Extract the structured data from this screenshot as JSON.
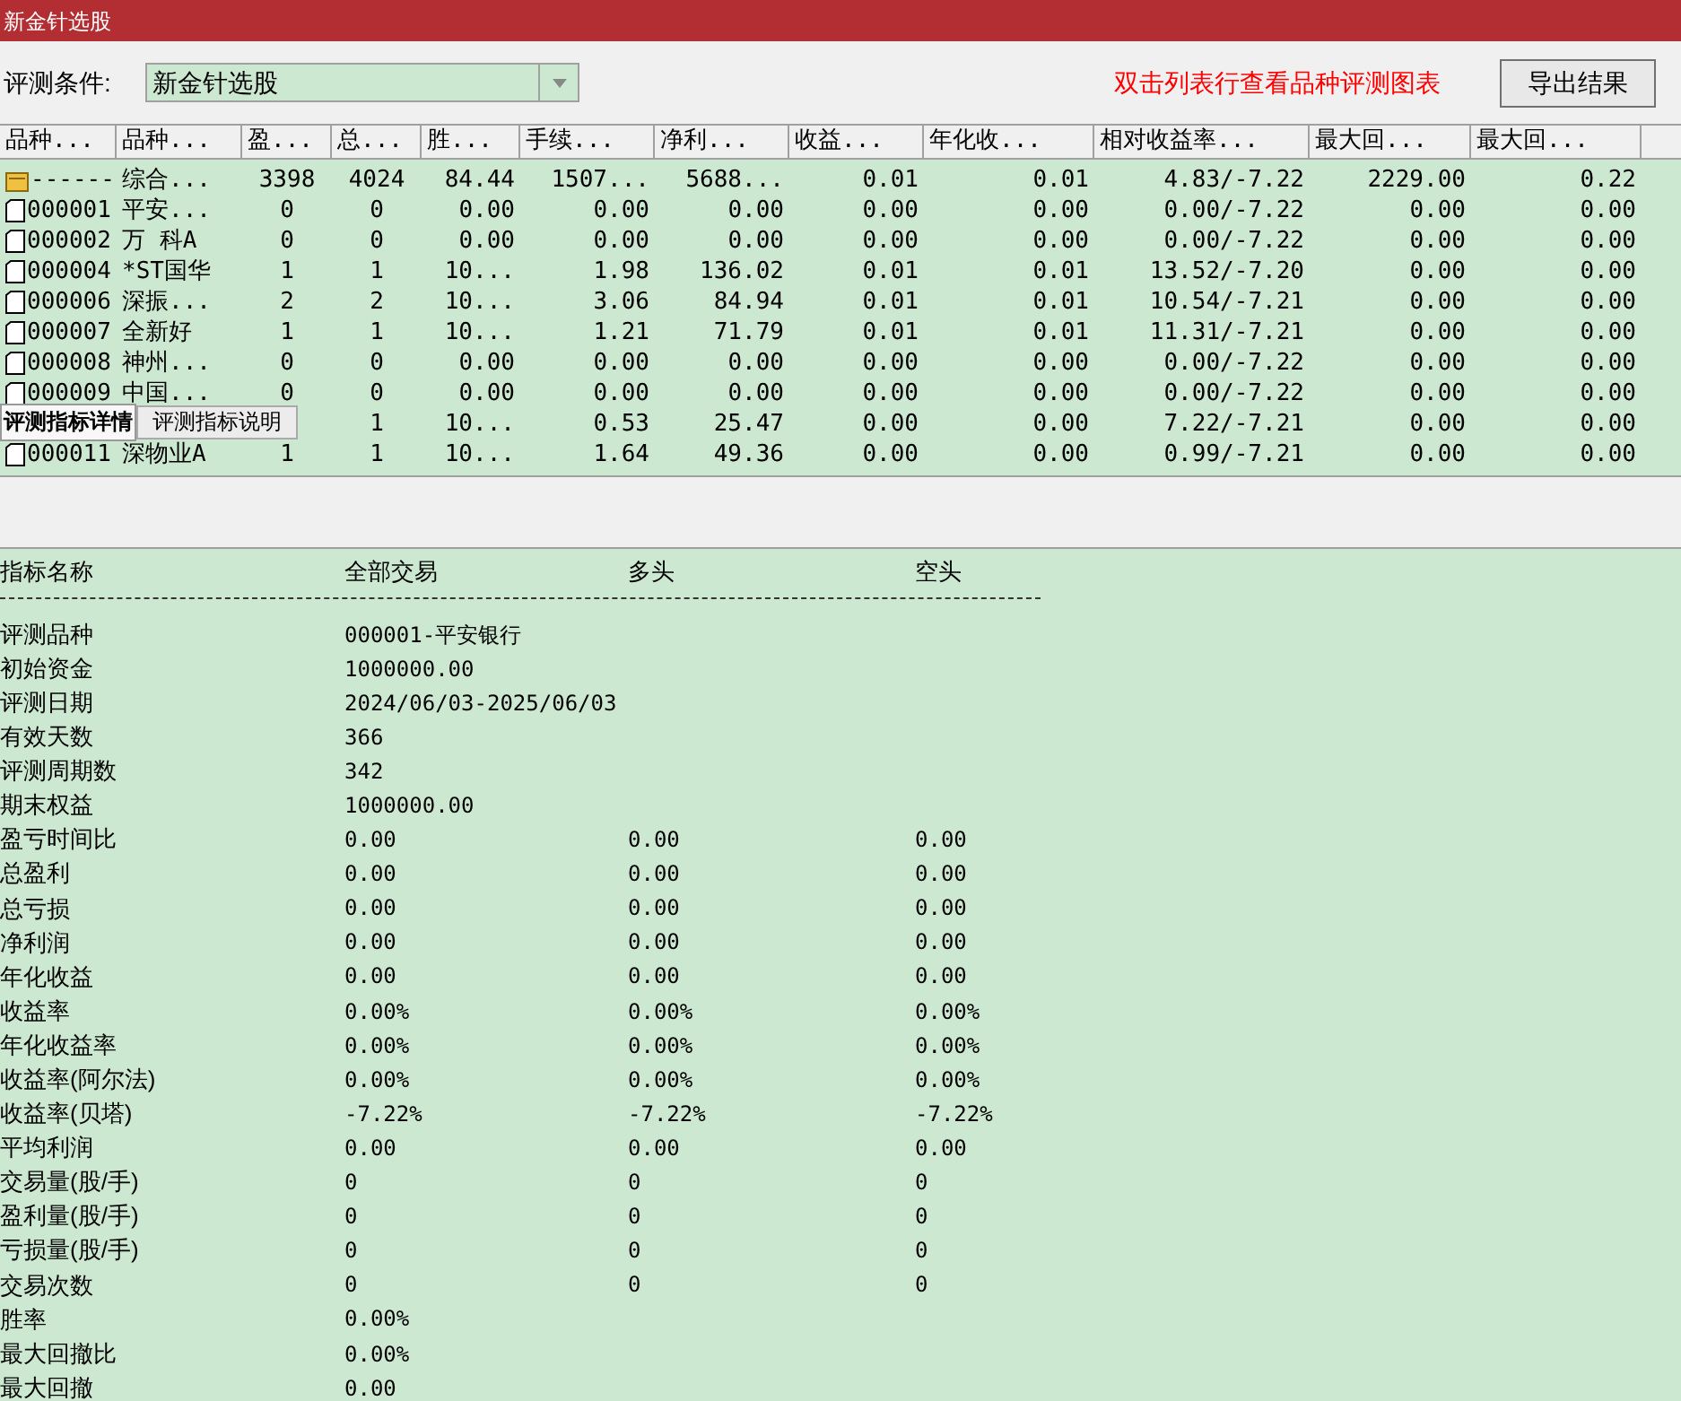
{
  "window": {
    "title": "新金针选股"
  },
  "toolbar": {
    "condition_label": "评测条件:",
    "condition_value": "新金针选股",
    "hint": "双击列表行查看品种评测图表",
    "export_button": "导出结果"
  },
  "table": {
    "columns": [
      "品种...",
      "品种...",
      "盈...",
      "总...",
      "胜...",
      "手续...",
      "净利...",
      "收益...",
      "年化收...",
      "相对收益率...",
      "最大回...",
      "最大回..."
    ],
    "rows": [
      {
        "kind": "summary",
        "cells": [
          "------",
          "综合...",
          "3398",
          "4024",
          "84.44",
          "1507...",
          "5688...",
          "0.01",
          "0.01",
          "4.83/-7.22",
          "2229.00",
          "0.22"
        ]
      },
      {
        "kind": "stock",
        "cells": [
          "000001",
          "平安...",
          "0",
          "0",
          "0.00",
          "0.00",
          "0.00",
          "0.00",
          "0.00",
          "0.00/-7.22",
          "0.00",
          "0.00"
        ]
      },
      {
        "kind": "stock",
        "cells": [
          "000002",
          "万 科A",
          "0",
          "0",
          "0.00",
          "0.00",
          "0.00",
          "0.00",
          "0.00",
          "0.00/-7.22",
          "0.00",
          "0.00"
        ]
      },
      {
        "kind": "stock",
        "cells": [
          "000004",
          "*ST国华",
          "1",
          "1",
          "10...",
          "1.98",
          "136.02",
          "0.01",
          "0.01",
          "13.52/-7.20",
          "0.00",
          "0.00"
        ]
      },
      {
        "kind": "stock",
        "cells": [
          "000006",
          "深振...",
          "2",
          "2",
          "10...",
          "3.06",
          "84.94",
          "0.01",
          "0.01",
          "10.54/-7.21",
          "0.00",
          "0.00"
        ]
      },
      {
        "kind": "stock",
        "cells": [
          "000007",
          " 全新好",
          "1",
          "1",
          "10...",
          "1.21",
          "71.79",
          "0.01",
          "0.01",
          "11.31/-7.21",
          "0.00",
          "0.00"
        ]
      },
      {
        "kind": "stock",
        "cells": [
          "000008",
          "神州...",
          "0",
          "0",
          "0.00",
          "0.00",
          "0.00",
          "0.00",
          "0.00",
          "0.00/-7.22",
          "0.00",
          "0.00"
        ]
      },
      {
        "kind": "stock",
        "cells": [
          "000009",
          "中国...",
          "0",
          "0",
          "0.00",
          "0.00",
          "0.00",
          "0.00",
          "0.00",
          "0.00/-7.22",
          "0.00",
          "0.00"
        ]
      },
      {
        "cells": [
          null,
          null,
          null,
          "1",
          "10...",
          "0.53",
          "25.47",
          "0.00",
          "0.00",
          "7.22/-7.21",
          "0.00",
          "0.00"
        ]
      },
      {
        "kind": "stock",
        "cells": [
          "000011",
          "深物业A",
          "1",
          "1",
          "10...",
          "1.64",
          "49.36",
          "0.00",
          "0.00",
          "0.99/-7.21",
          "0.00",
          "0.00"
        ]
      }
    ]
  },
  "tabs": [
    {
      "label": "评测指标详情",
      "selected": true
    },
    {
      "label": "评测指标说明",
      "selected": false
    }
  ],
  "details": {
    "columns": [
      "指标名称",
      "全部交易",
      "多头",
      "空头"
    ],
    "rows": [
      [
        "评测品种",
        "000001-平安银行"
      ],
      [
        "初始资金",
        "1000000.00"
      ],
      [
        "评测日期",
        "2024/06/03-2025/06/03"
      ],
      [
        "有效天数",
        "366"
      ],
      [
        "评测周期数",
        "342"
      ],
      [
        "期末权益",
        "1000000.00"
      ],
      [
        "盈亏时间比",
        "0.00",
        "0.00",
        "0.00"
      ],
      [
        "总盈利",
        "0.00",
        "0.00",
        "0.00"
      ],
      [
        "总亏损",
        "0.00",
        "0.00",
        "0.00"
      ],
      [
        "净利润",
        "0.00",
        "0.00",
        "0.00"
      ],
      [
        "年化收益",
        "0.00",
        "0.00",
        "0.00"
      ],
      [
        "收益率",
        "0.00%",
        "0.00%",
        "0.00%"
      ],
      [
        "年化收益率",
        "0.00%",
        "0.00%",
        "0.00%"
      ],
      [
        "收益率(阿尔法)",
        "0.00%",
        "0.00%",
        "0.00%"
      ],
      [
        "收益率(贝塔)",
        "-7.22%",
        "-7.22%",
        "-7.22%"
      ],
      [
        "平均利润",
        "0.00",
        "0.00",
        "0.00"
      ],
      [
        "交易量(股/手)",
        "0",
        "0",
        "0"
      ],
      [
        "盈利量(股/手)",
        "0",
        "0",
        "0"
      ],
      [
        "亏损量(股/手)",
        "0",
        "0",
        "0"
      ],
      [
        "交易次数",
        "0",
        "0",
        "0"
      ],
      [
        "胜率",
        "0.00%"
      ],
      [
        "最大回撤比",
        "0.00%"
      ],
      [
        "最大回撤",
        "0.00"
      ]
    ]
  }
}
